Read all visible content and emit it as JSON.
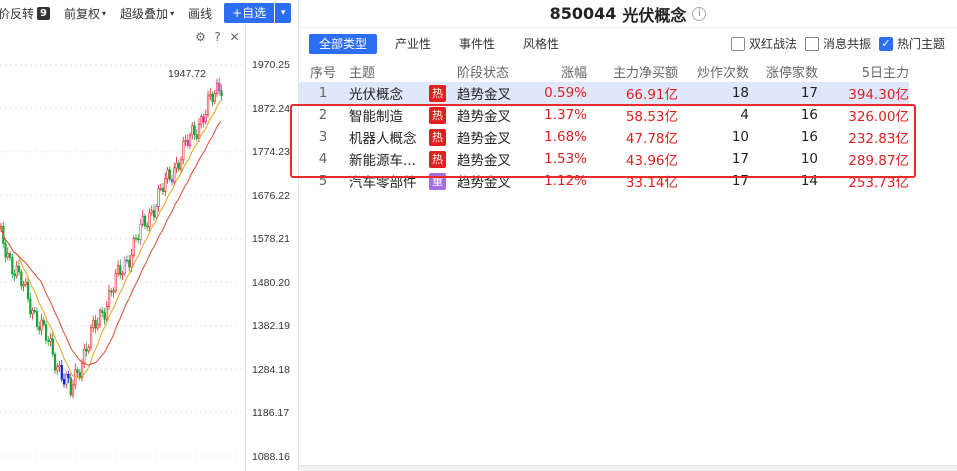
{
  "toolbar": {
    "items": [
      {
        "label": "价反转",
        "badge": "9"
      },
      {
        "label": "前复权",
        "caret": "▾"
      },
      {
        "label": "超级叠加",
        "caret": "▾"
      },
      {
        "label": "画线"
      }
    ],
    "custom_button": "+自选",
    "custom_dropdown": "▾"
  },
  "chart": {
    "axis_labels": [
      "1970.25",
      "1872.24",
      "1774.23",
      "1676.22",
      "1578.21",
      "1480.20",
      "1382.19",
      "1284.18",
      "1186.17",
      "1088.16"
    ],
    "max_label": "1947.72",
    "icons": [
      "settings-icon",
      "help-icon",
      "close-icon"
    ],
    "icon_glyphs": {
      "settings": "⚙",
      "help": "?",
      "close": "✕"
    }
  },
  "panel": {
    "code": "850044",
    "name": "光伏概念",
    "info_glyph": "i",
    "tabs": [
      "全部类型",
      "产业性",
      "事件性",
      "风格性"
    ],
    "checkboxes": [
      {
        "label": "双红战法",
        "checked": false
      },
      {
        "label": "消息共振",
        "checked": false
      },
      {
        "label": "热门主题",
        "checked": true
      }
    ],
    "columns": [
      "序号",
      "主题",
      "阶段状态",
      "涨幅",
      "主力净买额",
      "炒作次数",
      "涨停家数",
      "5日主力"
    ],
    "rows": [
      {
        "idx": "1",
        "name": "光伏概念",
        "tag": "热",
        "tag_type": "hot",
        "stage": "趋势金叉",
        "pct": "0.59%",
        "flow": "66.91亿",
        "spec": "18",
        "limit": "17",
        "five": "394.30亿",
        "selected": true
      },
      {
        "idx": "2",
        "name": "智能制造",
        "tag": "热",
        "tag_type": "hot",
        "stage": "趋势金叉",
        "pct": "1.37%",
        "flow": "58.53亿",
        "spec": "4",
        "limit": "16",
        "five": "326.00亿"
      },
      {
        "idx": "3",
        "name": "机器人概念",
        "tag": "热",
        "tag_type": "hot",
        "stage": "趋势金叉",
        "pct": "1.68%",
        "flow": "47.78亿",
        "spec": "10",
        "limit": "16",
        "five": "232.83亿"
      },
      {
        "idx": "4",
        "name": "新能源车...",
        "tag": "热",
        "tag_type": "hot",
        "stage": "趋势金叉",
        "pct": "1.53%",
        "flow": "43.96亿",
        "spec": "17",
        "limit": "10",
        "five": "289.87亿"
      },
      {
        "idx": "5",
        "name": "汽车零部件",
        "tag": "重",
        "tag_type": "heavy",
        "stage": "趋势金叉",
        "pct": "1.12%",
        "flow": "33.14亿",
        "spec": "17",
        "limit": "14",
        "five": "253.73亿"
      }
    ]
  },
  "colors": {
    "accent": "#2c6ef2",
    "up": "#e0201f",
    "down": "#19a337",
    "hot_tag": "#e02020",
    "heavy_tag": "#a96be2",
    "highlight_box": "#e82c2c"
  }
}
